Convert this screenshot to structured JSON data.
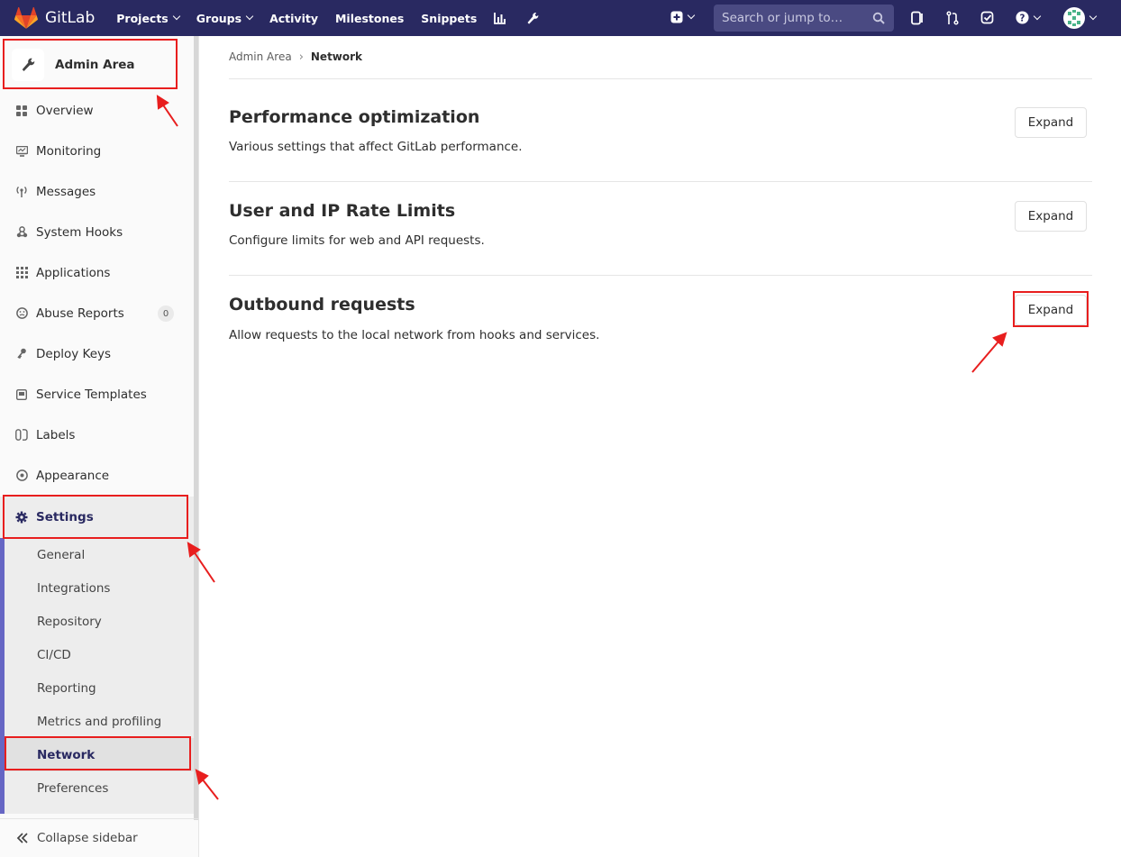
{
  "navbar": {
    "brand": "GitLab",
    "links": [
      {
        "label": "Projects",
        "dropdown": true
      },
      {
        "label": "Groups",
        "dropdown": true
      },
      {
        "label": "Activity",
        "dropdown": false
      },
      {
        "label": "Milestones",
        "dropdown": false
      },
      {
        "label": "Snippets",
        "dropdown": false
      }
    ],
    "search_placeholder": "Search or jump to…"
  },
  "sidebar": {
    "title": "Admin Area",
    "items": [
      {
        "label": "Overview",
        "icon": "overview-icon"
      },
      {
        "label": "Monitoring",
        "icon": "monitor-icon"
      },
      {
        "label": "Messages",
        "icon": "broadcast-icon"
      },
      {
        "label": "System Hooks",
        "icon": "hook-icon"
      },
      {
        "label": "Applications",
        "icon": "grid-icon"
      },
      {
        "label": "Abuse Reports",
        "icon": "face-icon",
        "badge": "0"
      },
      {
        "label": "Deploy Keys",
        "icon": "key-icon"
      },
      {
        "label": "Service Templates",
        "icon": "template-icon"
      },
      {
        "label": "Labels",
        "icon": "label-icon"
      },
      {
        "label": "Appearance",
        "icon": "palette-icon"
      }
    ],
    "settings": {
      "label": "Settings",
      "sub_items": [
        "General",
        "Integrations",
        "Repository",
        "CI/CD",
        "Reporting",
        "Metrics and profiling",
        "Network",
        "Preferences"
      ],
      "active": "Network"
    },
    "collapse_label": "Collapse sidebar"
  },
  "breadcrumb": {
    "parent": "Admin Area",
    "current": "Network"
  },
  "sections": [
    {
      "title": "Performance optimization",
      "description": "Various settings that affect GitLab performance.",
      "button": "Expand"
    },
    {
      "title": "User and IP Rate Limits",
      "description": "Configure limits for web and API requests.",
      "button": "Expand"
    },
    {
      "title": "Outbound requests",
      "description": "Allow requests to the local network from hooks and services.",
      "button": "Expand"
    }
  ],
  "colors": {
    "navbar": "#292961",
    "highlight": "#e81e1e",
    "accent": "#6666c4"
  }
}
